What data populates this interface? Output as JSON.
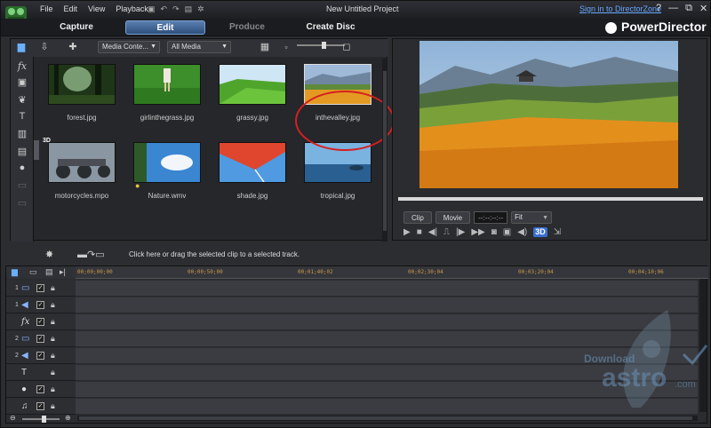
{
  "menu": {
    "items": [
      "File",
      "Edit",
      "View",
      "Playback"
    ],
    "project_title": "New Untitled Project",
    "signin_link": "Sign in to DirectorZone",
    "window_buttons": [
      "?",
      "—",
      "⧉",
      "✕"
    ]
  },
  "modes": {
    "capture": "Capture",
    "edit": "Edit",
    "produce": "Produce",
    "create_disc": "Create Disc",
    "active": "Edit"
  },
  "brand": "PowerDirector",
  "library": {
    "filter_dropdown": "Media Conte...",
    "media_dropdown": "All Media",
    "items": [
      {
        "label": "forest.jpg"
      },
      {
        "label": "girlinthegrass.jpg"
      },
      {
        "label": "grassy.jpg"
      },
      {
        "label": "inthevalley.jpg",
        "selected": true
      },
      {
        "label": "motorcycles.mpo",
        "badge": "3D"
      },
      {
        "label": "Nature.wmv"
      },
      {
        "label": "shade.jpg"
      },
      {
        "label": "tropical.jpg"
      }
    ]
  },
  "preview": {
    "clip_button": "Clip",
    "movie_button": "Movie",
    "timecode": "--:--:--:--",
    "fit": "Fit",
    "badge_3d": "3D"
  },
  "infobar": {
    "hint": "Click here or drag the selected clip to a selected track."
  },
  "timeline": {
    "ruler": [
      "00;00;00;00",
      "00;00;50;00",
      "00;01;40;02",
      "00;02;30;04",
      "00;03;20;04",
      "00;04;10;06"
    ],
    "tracks": [
      {
        "num": "1",
        "kind": "video-track",
        "glyph": "▭"
      },
      {
        "num": "1",
        "kind": "audio-track",
        "glyph": "◀"
      },
      {
        "num": "",
        "kind": "fx-track",
        "glyph": "fx"
      },
      {
        "num": "2",
        "kind": "video-track",
        "glyph": "▭"
      },
      {
        "num": "2",
        "kind": "audio-track",
        "glyph": "◀"
      },
      {
        "num": "",
        "kind": "title-track",
        "glyph": "T"
      },
      {
        "num": "",
        "kind": "voice-track",
        "glyph": "●"
      },
      {
        "num": "",
        "kind": "music-track",
        "glyph": "♫"
      }
    ]
  },
  "watermark": {
    "line1": "Download",
    "line2": "astro",
    "line3": ".com"
  },
  "colors": {
    "accent": "#3a6fd0",
    "highlight_circle": "#d42020",
    "ruler_text": "#c89a4a"
  }
}
